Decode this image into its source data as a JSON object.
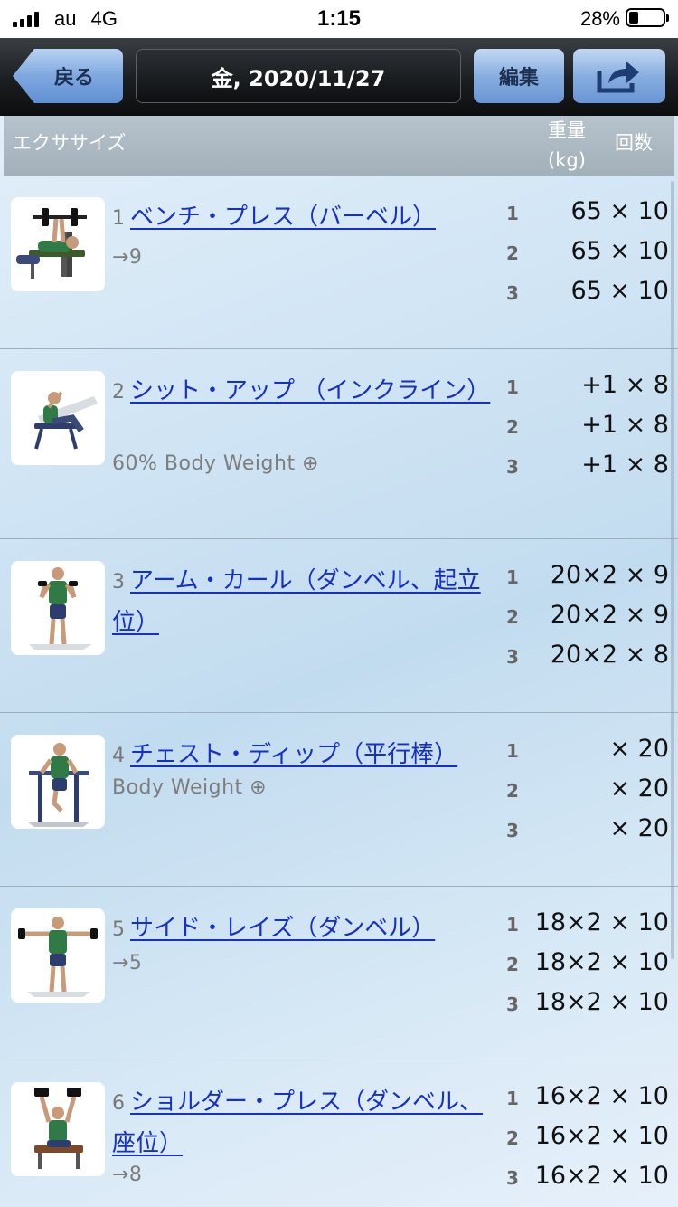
{
  "status_bar": {
    "carrier": "au",
    "network": "4G",
    "time": "1:15",
    "battery_percent_text": "28%",
    "battery_level": 0.28
  },
  "nav": {
    "back_label": "戻る",
    "title": "金, 2020/11/27",
    "edit_label": "編集",
    "share_icon": "share-icon"
  },
  "header": {
    "exercise": "エクササイズ",
    "weight_line1": "重量",
    "weight_line2": "(kg)",
    "reps": "回数"
  },
  "exercises": [
    {
      "number": "1",
      "name": "ベンチ・プレス（バーベル）",
      "sub": "→9",
      "sets": [
        {
          "no": "1",
          "value": "65 × 10"
        },
        {
          "no": "2",
          "value": "65 × 10"
        },
        {
          "no": "3",
          "value": "65 × 10"
        }
      ]
    },
    {
      "number": "2",
      "name": "シット・アップ （インクライン）",
      "sub": "60% Body Weight ⊕",
      "sets": [
        {
          "no": "1",
          "value": "+1 × 8"
        },
        {
          "no": "2",
          "value": "+1 × 8"
        },
        {
          "no": "3",
          "value": "+1 × 8"
        }
      ]
    },
    {
      "number": "3",
      "name": "アーム・カール（ダンベル、起立位）",
      "sub": "",
      "sets": [
        {
          "no": "1",
          "value": "20×2 × 9"
        },
        {
          "no": "2",
          "value": "20×2 × 9"
        },
        {
          "no": "3",
          "value": "20×2 × 8"
        }
      ]
    },
    {
      "number": "4",
      "name": "チェスト・ディップ（平行棒）",
      "sub": "Body Weight ⊕",
      "sets": [
        {
          "no": "1",
          "value": "× 20"
        },
        {
          "no": "2",
          "value": "× 20"
        },
        {
          "no": "3",
          "value": "× 20"
        }
      ]
    },
    {
      "number": "5",
      "name": "サイド・レイズ（ダンベル）",
      "sub": "→5",
      "sets": [
        {
          "no": "1",
          "value": "18×2 × 10"
        },
        {
          "no": "2",
          "value": "18×2 × 10"
        },
        {
          "no": "3",
          "value": "18×2 × 10"
        }
      ]
    },
    {
      "number": "6",
      "name": "ショルダー・プレス（ダンベル、座位）",
      "sub": "→8",
      "sets": [
        {
          "no": "1",
          "value": "16×2 × 10"
        },
        {
          "no": "2",
          "value": "16×2 × 10"
        },
        {
          "no": "3",
          "value": "16×2 × 10"
        }
      ]
    }
  ]
}
